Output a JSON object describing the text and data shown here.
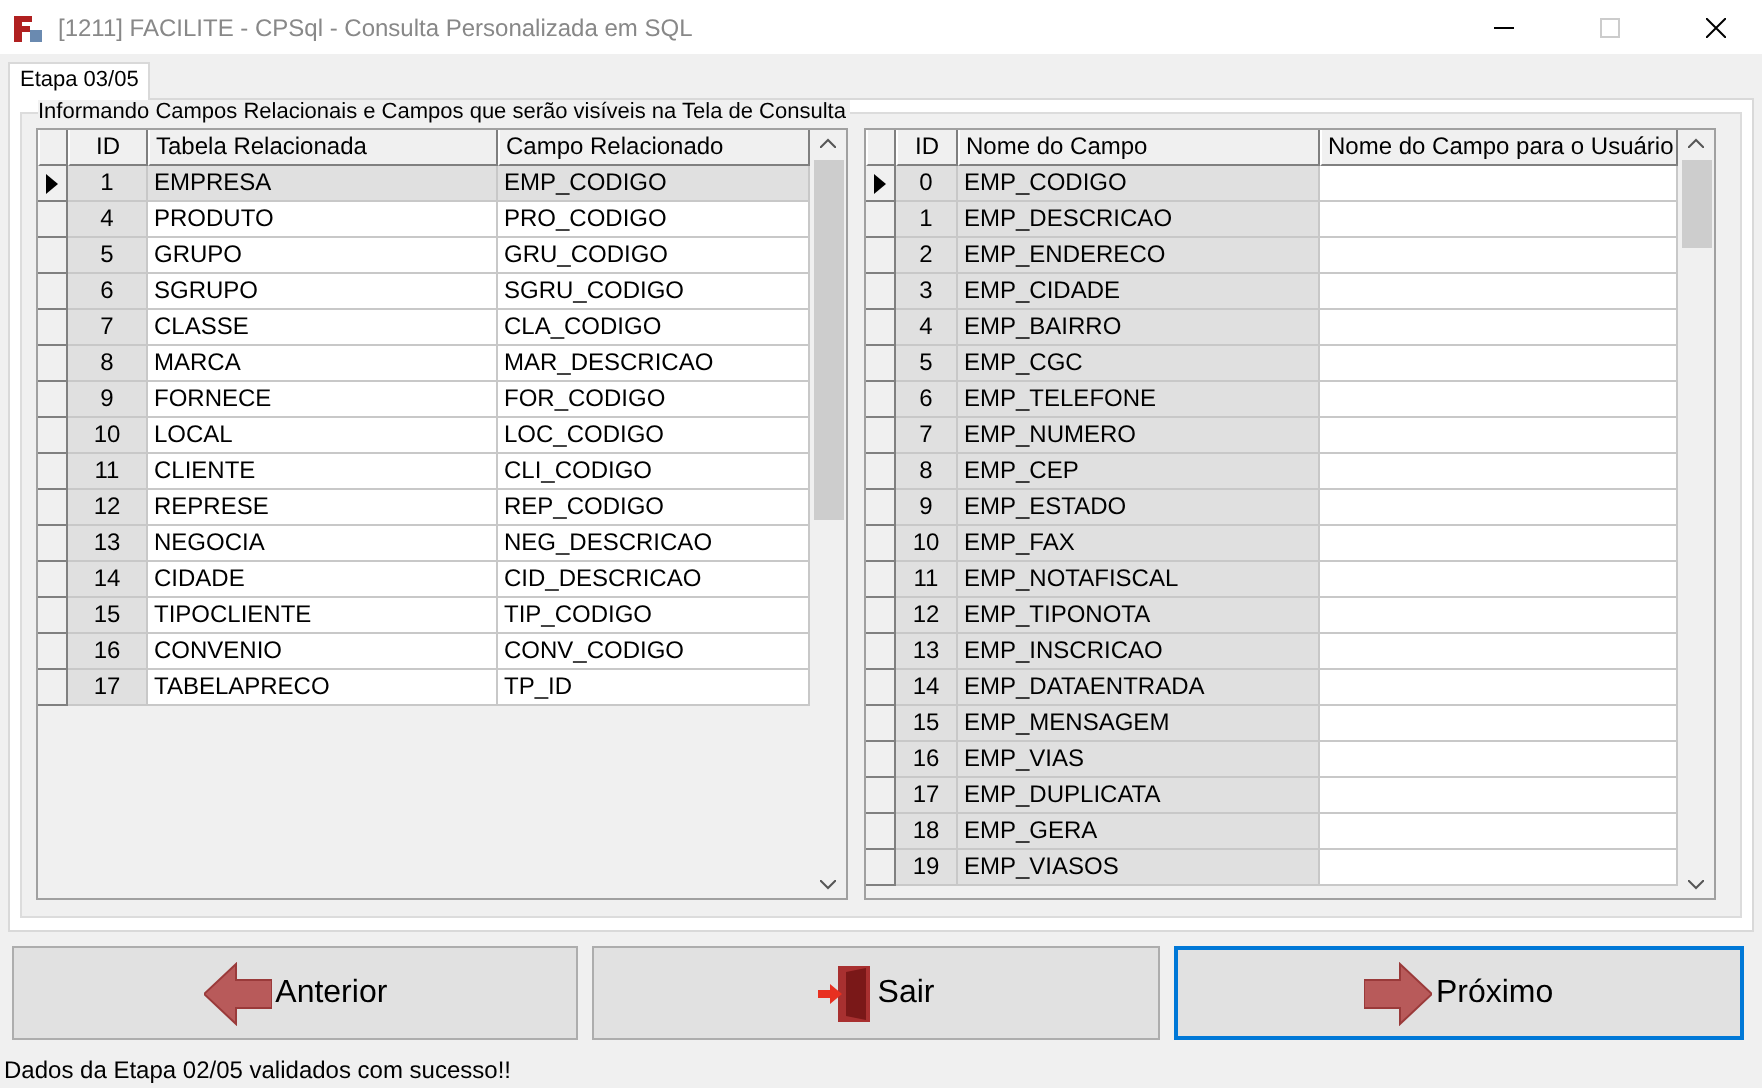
{
  "window": {
    "title": "[1211] FACILITE - CPSql - Consulta Personalizada em SQL"
  },
  "tabs": [
    {
      "label": "Etapa 03/05",
      "selected": true
    }
  ],
  "group": {
    "title": "Informando Campos Relacionais e Campos que serão visíveis na Tela de Consulta"
  },
  "grids": [
    {
      "columns": [
        {
          "label": "ID",
          "shaded": true
        },
        {
          "label": "Tabela Relacionada",
          "shaded": false
        },
        {
          "label": "Campo Relacionado",
          "shaded": false
        }
      ],
      "rows": [
        {
          "selected": true,
          "cells": [
            "1",
            "EMPRESA",
            "EMP_CODIGO"
          ]
        },
        {
          "selected": false,
          "cells": [
            "4",
            "PRODUTO",
            "PRO_CODIGO"
          ]
        },
        {
          "selected": false,
          "cells": [
            "5",
            "GRUPO",
            "GRU_CODIGO"
          ]
        },
        {
          "selected": false,
          "cells": [
            "6",
            "SGRUPO",
            "SGRU_CODIGO"
          ]
        },
        {
          "selected": false,
          "cells": [
            "7",
            "CLASSE",
            "CLA_CODIGO"
          ]
        },
        {
          "selected": false,
          "cells": [
            "8",
            "MARCA",
            "MAR_DESCRICAO"
          ]
        },
        {
          "selected": false,
          "cells": [
            "9",
            "FORNECE",
            "FOR_CODIGO"
          ]
        },
        {
          "selected": false,
          "cells": [
            "10",
            "LOCAL",
            "LOC_CODIGO"
          ]
        },
        {
          "selected": false,
          "cells": [
            "11",
            "CLIENTE",
            "CLI_CODIGO"
          ]
        },
        {
          "selected": false,
          "cells": [
            "12",
            "REPRESE",
            "REP_CODIGO"
          ]
        },
        {
          "selected": false,
          "cells": [
            "13",
            "NEGOCIA",
            "NEG_DESCRICAO"
          ]
        },
        {
          "selected": false,
          "cells": [
            "14",
            "CIDADE",
            "CID_DESCRICAO"
          ]
        },
        {
          "selected": false,
          "cells": [
            "15",
            "TIPOCLIENTE",
            "TIP_CODIGO"
          ]
        },
        {
          "selected": false,
          "cells": [
            "16",
            "CONVENIO",
            "CONV_CODIGO"
          ]
        },
        {
          "selected": false,
          "cells": [
            "17",
            "TABELAPRECO",
            "TP_ID"
          ]
        }
      ]
    },
    {
      "columns": [
        {
          "label": "ID",
          "shaded": true
        },
        {
          "label": "Nome do Campo",
          "shaded": true
        },
        {
          "label": "Nome do Campo para o Usuário",
          "shaded": false
        }
      ],
      "rows": [
        {
          "selected": true,
          "cells": [
            "0",
            "EMP_CODIGO",
            ""
          ]
        },
        {
          "selected": false,
          "cells": [
            "1",
            "EMP_DESCRICAO",
            ""
          ]
        },
        {
          "selected": false,
          "cells": [
            "2",
            "EMP_ENDERECO",
            ""
          ]
        },
        {
          "selected": false,
          "cells": [
            "3",
            "EMP_CIDADE",
            ""
          ]
        },
        {
          "selected": false,
          "cells": [
            "4",
            "EMP_BAIRRO",
            ""
          ]
        },
        {
          "selected": false,
          "cells": [
            "5",
            "EMP_CGC",
            ""
          ]
        },
        {
          "selected": false,
          "cells": [
            "6",
            "EMP_TELEFONE",
            ""
          ]
        },
        {
          "selected": false,
          "cells": [
            "7",
            "EMP_NUMERO",
            ""
          ]
        },
        {
          "selected": false,
          "cells": [
            "8",
            "EMP_CEP",
            ""
          ]
        },
        {
          "selected": false,
          "cells": [
            "9",
            "EMP_ESTADO",
            ""
          ]
        },
        {
          "selected": false,
          "cells": [
            "10",
            "EMP_FAX",
            ""
          ]
        },
        {
          "selected": false,
          "cells": [
            "11",
            "EMP_NOTAFISCAL",
            ""
          ]
        },
        {
          "selected": false,
          "cells": [
            "12",
            "EMP_TIPONOTA",
            ""
          ]
        },
        {
          "selected": false,
          "cells": [
            "13",
            "EMP_INSCRICAO",
            ""
          ]
        },
        {
          "selected": false,
          "cells": [
            "14",
            "EMP_DATAENTRADA",
            ""
          ]
        },
        {
          "selected": false,
          "cells": [
            "15",
            "EMP_MENSAGEM",
            ""
          ]
        },
        {
          "selected": false,
          "cells": [
            "16",
            "EMP_VIAS",
            ""
          ]
        },
        {
          "selected": false,
          "cells": [
            "17",
            "EMP_DUPLICATA",
            ""
          ]
        },
        {
          "selected": false,
          "cells": [
            "18",
            "EMP_GERA",
            ""
          ]
        },
        {
          "selected": false,
          "cells": [
            "19",
            "EMP_VIASOS",
            ""
          ]
        }
      ]
    }
  ],
  "buttons": [
    {
      "label": "Anterior",
      "kind": "back",
      "focused": false
    },
    {
      "label": "Sair",
      "kind": "exit",
      "focused": false
    },
    {
      "label": "Próximo",
      "kind": "next",
      "focused": true
    }
  ],
  "status_bar": "Dados da Etapa 02/05 validados com sucesso!!"
}
